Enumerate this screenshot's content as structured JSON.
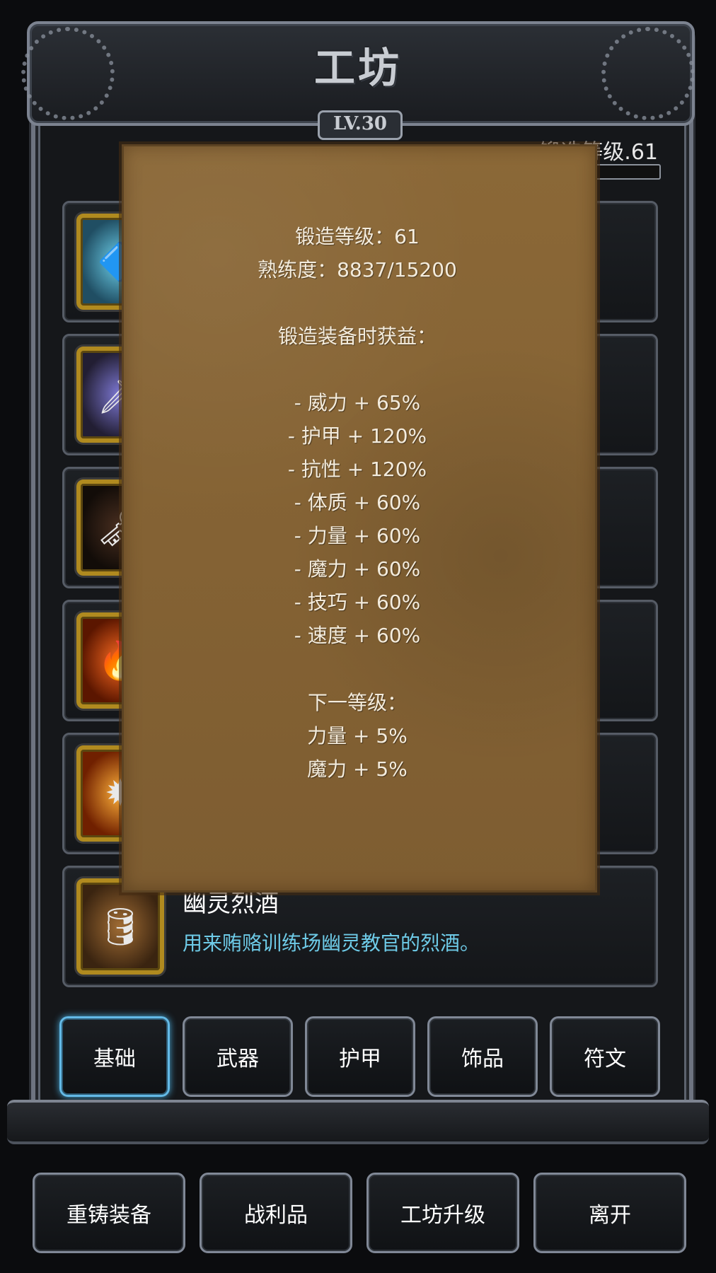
{
  "header": {
    "title": "工坊",
    "level": "LV.30",
    "forge_label": "锻造等级.61"
  },
  "items": [
    {
      "title": "",
      "desc": "",
      "icon": "crystal-icon"
    },
    {
      "title": "",
      "desc": "",
      "icon": "hilt-icon"
    },
    {
      "title": "",
      "desc": "",
      "icon": "key-icon"
    },
    {
      "title": "",
      "desc": "",
      "icon": "fire-orb-icon"
    },
    {
      "title": "",
      "desc": "。",
      "icon": "flame-cube-icon"
    },
    {
      "title": "幽灵烈酒",
      "desc": "用来贿赂训练场幽灵教官的烈酒。",
      "icon": "barrel-icon"
    }
  ],
  "popup": {
    "forge_level": "锻造等级：61",
    "proficiency": "熟练度：8837/15200",
    "gain_title": "锻造装备时获益：",
    "bonuses": [
      "- 威力 + 65%",
      "- 护甲 + 120%",
      "- 抗性 + 120%",
      "- 体质 + 60%",
      "- 力量 + 60%",
      "- 魔力 + 60%",
      "- 技巧 + 60%",
      "- 速度 + 60%"
    ],
    "next_title": "下一等级：",
    "next_bonuses": [
      "力量 + 5%",
      "魔力 + 5%"
    ]
  },
  "tabs": [
    {
      "label": "基础",
      "active": true
    },
    {
      "label": "武器",
      "active": false
    },
    {
      "label": "护甲",
      "active": false
    },
    {
      "label": "饰品",
      "active": false
    },
    {
      "label": "符文",
      "active": false
    }
  ],
  "actions": [
    "重铸装备",
    "战利品",
    "工坊升级",
    "离开"
  ]
}
